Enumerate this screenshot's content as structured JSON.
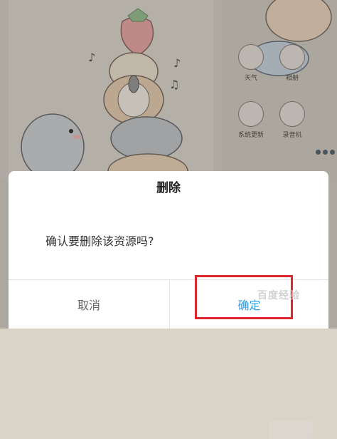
{
  "background": {
    "apps_row1": [
      {
        "label": "天气",
        "icon": "weather-icon"
      },
      {
        "label": "相册",
        "icon": "gallery-icon"
      }
    ],
    "apps_row2": [
      {
        "label": "系统更新",
        "icon": "system-update-icon"
      },
      {
        "label": "录音机",
        "icon": "recorder-icon"
      }
    ]
  },
  "dialog": {
    "title": "删除",
    "message": "确认要删除该资源吗?",
    "cancel_label": "取消",
    "confirm_label": "确定"
  },
  "watermark": "百度经验",
  "colors": {
    "confirm": "#2a9fe8",
    "highlight": "#e0252b"
  }
}
